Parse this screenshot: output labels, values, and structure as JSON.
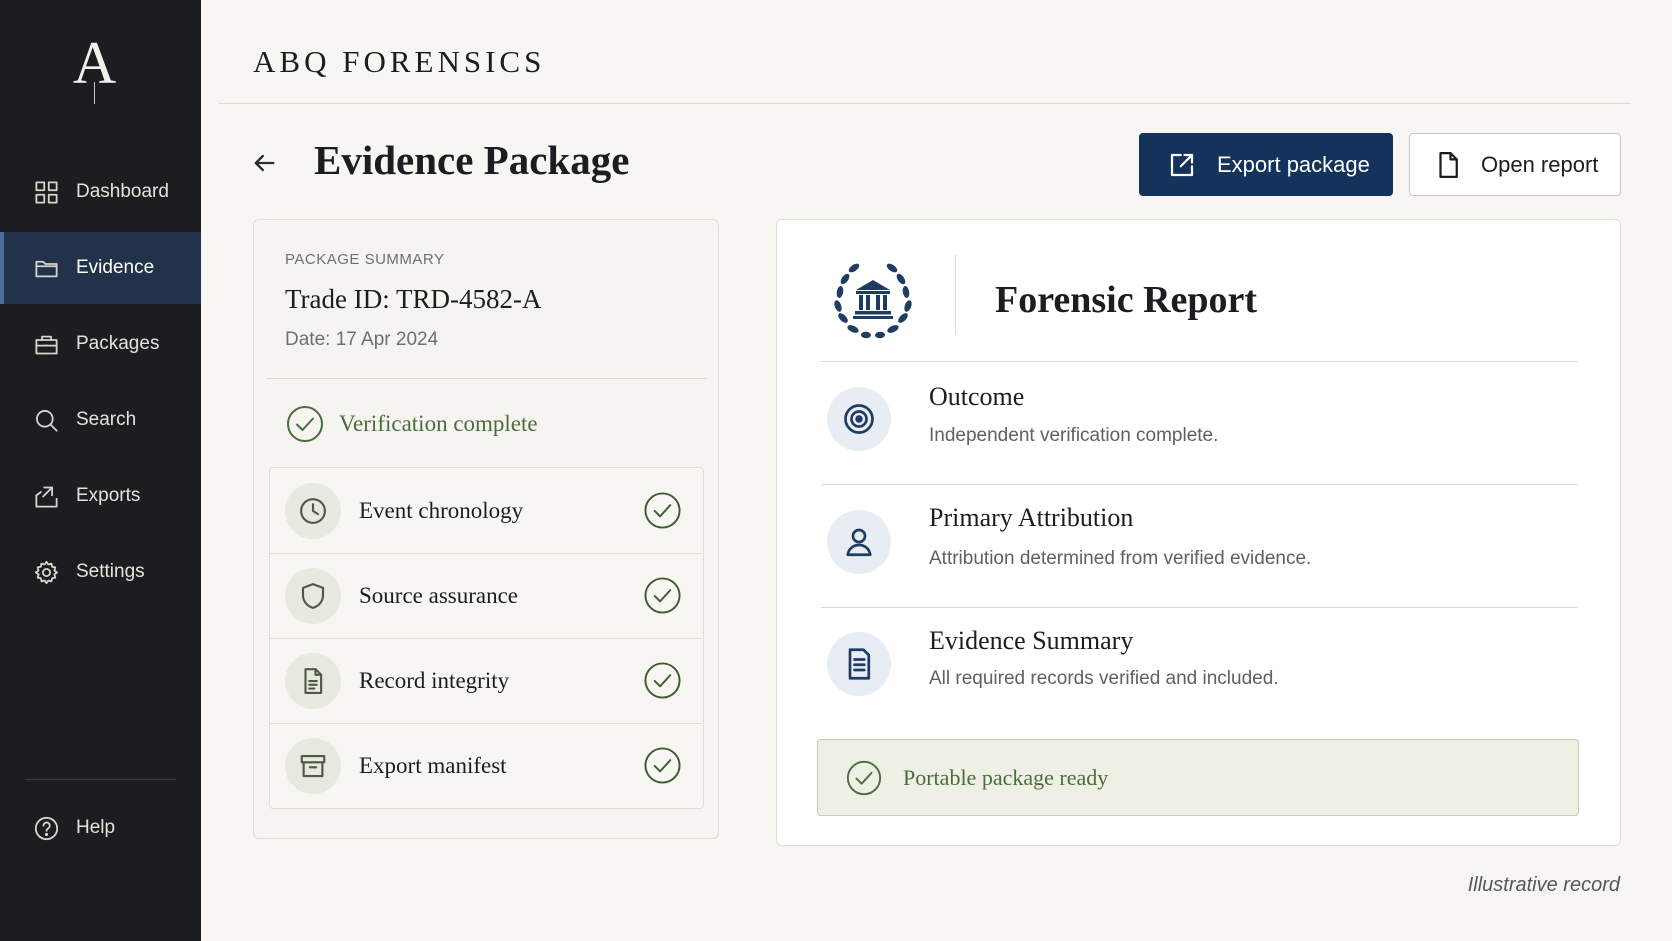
{
  "app": {
    "logo_letter": "A",
    "brand": "ABQ FORENSICS"
  },
  "sidebar": {
    "items": [
      {
        "label": "Dashboard",
        "icon": "grid-icon"
      },
      {
        "label": "Evidence",
        "icon": "folder-icon",
        "active": true
      },
      {
        "label": "Packages",
        "icon": "briefcase-icon"
      },
      {
        "label": "Search",
        "icon": "search-icon"
      },
      {
        "label": "Exports",
        "icon": "export-icon"
      },
      {
        "label": "Settings",
        "icon": "gear-icon"
      }
    ],
    "help": {
      "label": "Help",
      "icon": "help-icon"
    }
  },
  "header": {
    "title": "Evidence Package",
    "export_label": "Export package",
    "open_report_label": "Open report"
  },
  "summary": {
    "section_label": "PACKAGE SUMMARY",
    "trade_id": "Trade ID: TRD-4582-A",
    "date": "Date: 17 Apr 2024",
    "verification": "Verification complete",
    "checks": [
      {
        "label": "Event chronology",
        "icon": "clock-icon",
        "status": "verified"
      },
      {
        "label": "Source assurance",
        "icon": "shield-icon",
        "status": "verified"
      },
      {
        "label": "Record integrity",
        "icon": "document-icon",
        "status": "verified"
      },
      {
        "label": "Export manifest",
        "icon": "archive-box-icon",
        "status": "verified"
      }
    ]
  },
  "report": {
    "title": "Forensic Report",
    "sections": [
      {
        "title": "Outcome",
        "description": "Independent verification complete.",
        "icon": "target-icon"
      },
      {
        "title": "Primary Attribution",
        "description": "Attribution determined from verified evidence.",
        "icon": "user-icon"
      },
      {
        "title": "Evidence Summary",
        "description": "All required records verified and included.",
        "icon": "document-list-icon"
      }
    ],
    "ready_banner": "Portable package ready"
  },
  "footnote": "Illustrative record",
  "colors": {
    "sidebar_bg": "#1b1d20",
    "primary": "#13335a",
    "success": "#4a6d3c",
    "page_bg": "#f7f6f3"
  }
}
